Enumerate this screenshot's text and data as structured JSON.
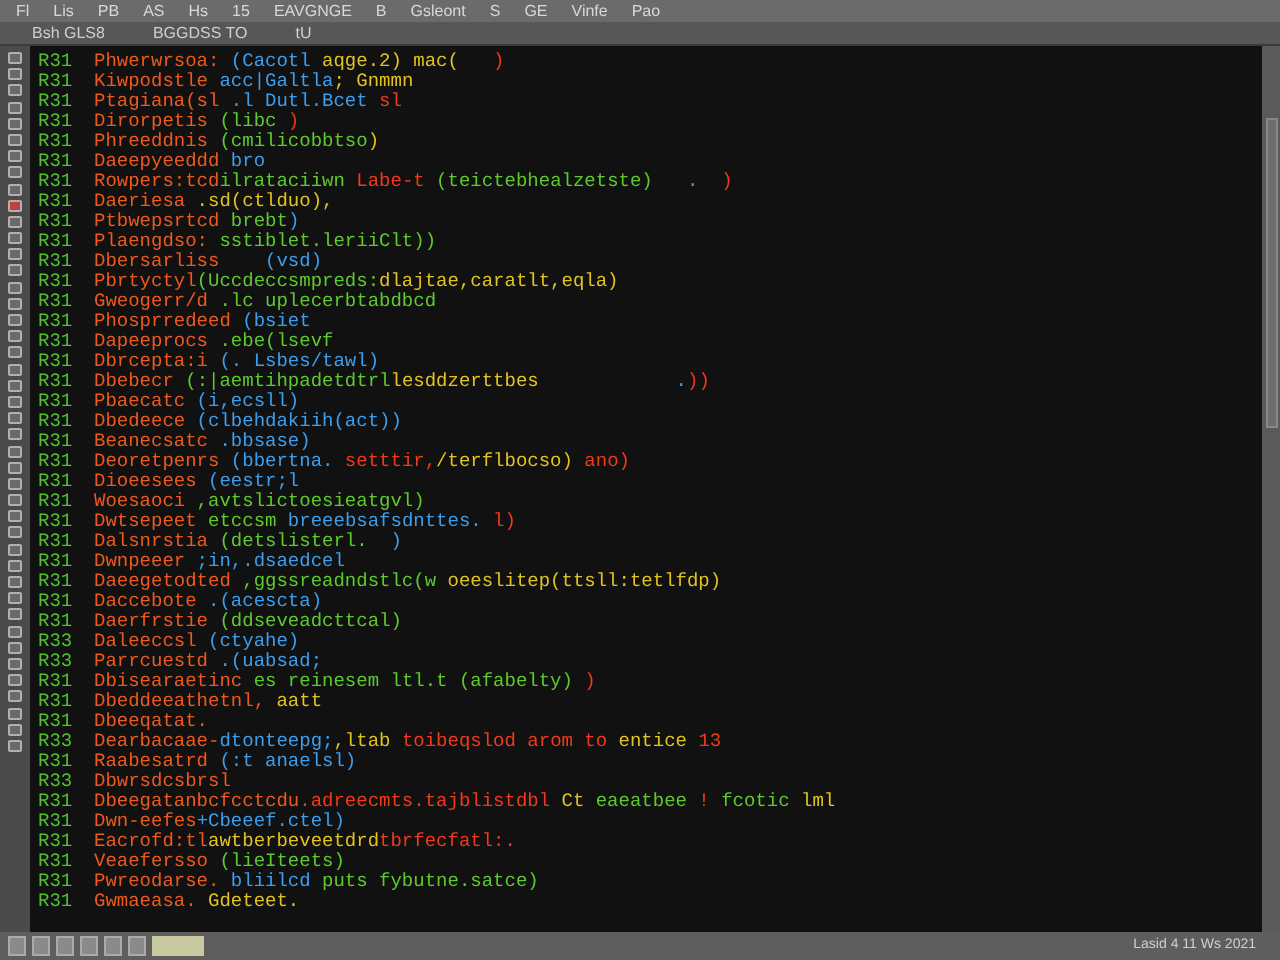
{
  "menu_bar": {
    "items": [
      "Fl",
      "Lis",
      "PB",
      "AS",
      "Hs",
      "15",
      "EAVGNGE",
      "B",
      "Gsleont",
      "S",
      "GE",
      "Vinfe",
      "Pao"
    ]
  },
  "toolbar": {
    "items": [
      "Bsh GLS8",
      "BGGDSS TO",
      "tU"
    ]
  },
  "editor": {
    "lines": [
      {
        "number": "R31",
        "tokens": [
          {
            "kind": "ident",
            "text": "Phwerwrsoa:"
          },
          {
            "kind": "call",
            "text": " (Cacotl"
          },
          {
            "kind": "literal",
            "text": " aqge.2) mac("
          },
          {
            "kind": "punct",
            "text": "   )"
          }
        ]
      },
      {
        "number": "R31",
        "tokens": [
          {
            "kind": "ident",
            "text": "Kiwpodstle"
          },
          {
            "kind": "call",
            "text": " acc|Galtla"
          },
          {
            "kind": "literal",
            "text": "; Gnmmn"
          }
        ]
      },
      {
        "number": "R31",
        "tokens": [
          {
            "kind": "ident",
            "text": "Ptagiana(sl"
          },
          {
            "kind": "call",
            "text": " .l Dutl.Bcet"
          },
          {
            "kind": "punct",
            "text": " sl"
          }
        ]
      },
      {
        "number": "R31",
        "tokens": [
          {
            "kind": "ident",
            "text": "Dirorpetis"
          },
          {
            "kind": "string",
            "text": " (libc"
          },
          {
            "kind": "punct",
            "text": " )"
          }
        ]
      },
      {
        "number": "R31",
        "tokens": [
          {
            "kind": "ident",
            "text": "Phreeddnis"
          },
          {
            "kind": "string",
            "text": " (cmilicobbtso"
          },
          {
            "kind": "literal",
            "text": ")"
          }
        ]
      },
      {
        "number": "R31",
        "tokens": [
          {
            "kind": "ident",
            "text": "Daeepyeeddd"
          },
          {
            "kind": "call",
            "text": " bro"
          }
        ]
      },
      {
        "number": "R31",
        "tokens": [
          {
            "kind": "ident",
            "text": "Rowpers:tcd"
          },
          {
            "kind": "string",
            "text": "ilrataciiwn"
          },
          {
            "kind": "punct",
            "text": " Labe-t"
          },
          {
            "kind": "string",
            "text": " (teictebhealzetste)"
          },
          {
            "kind": "call",
            "text": "   ."
          },
          {
            "kind": "punct",
            "text": "  )"
          }
        ]
      },
      {
        "number": "R31",
        "tokens": [
          {
            "kind": "ident",
            "text": "Daeriesa"
          },
          {
            "kind": "literal",
            "text": " .sd(ctlduo),"
          }
        ]
      },
      {
        "number": "R31",
        "tokens": [
          {
            "kind": "ident",
            "text": "Ptbwepsrtcd"
          },
          {
            "kind": "string",
            "text": " brebt"
          },
          {
            "kind": "call",
            "text": ")"
          }
        ]
      },
      {
        "number": "R31",
        "tokens": [
          {
            "kind": "ident",
            "text": "Plaengdso:"
          },
          {
            "kind": "string",
            "text": " sstiblet.leriiClt))"
          }
        ]
      },
      {
        "number": "R31",
        "tokens": [
          {
            "kind": "ident",
            "text": "Dbersarliss"
          },
          {
            "kind": "call",
            "text": "    (vsd)"
          }
        ]
      },
      {
        "number": "R31",
        "tokens": [
          {
            "kind": "ident",
            "text": "Pbrtyctyl"
          },
          {
            "kind": "string",
            "text": "(Uccdeccsmpreds:"
          },
          {
            "kind": "literal",
            "text": "dlajtae,caratlt,eqla)"
          }
        ]
      },
      {
        "number": "R31",
        "tokens": [
          {
            "kind": "ident",
            "text": "Gweogerr/d"
          },
          {
            "kind": "string",
            "text": " .lc uplecerbtabdbcd"
          }
        ]
      },
      {
        "number": "R31",
        "tokens": [
          {
            "kind": "ident",
            "text": "Phosprredeed"
          },
          {
            "kind": "call",
            "text": " (bsiet"
          }
        ]
      },
      {
        "number": "R31",
        "tokens": [
          {
            "kind": "ident",
            "text": "Dapeeprocs"
          },
          {
            "kind": "string",
            "text": " .ebe(lsevf"
          }
        ]
      },
      {
        "number": "R31",
        "tokens": [
          {
            "kind": "ident",
            "text": "Dbrcepta:i"
          },
          {
            "kind": "call",
            "text": " (. Lsbes/tawl)"
          }
        ]
      },
      {
        "number": "R31",
        "tokens": [
          {
            "kind": "ident",
            "text": "Dbebecr"
          },
          {
            "kind": "string",
            "text": " (:|aemtihpadetdtrl"
          },
          {
            "kind": "literal",
            "text": "lesddzerttbes"
          },
          {
            "kind": "call",
            "text": "            ."
          },
          {
            "kind": "punct",
            "text": "))"
          }
        ]
      },
      {
        "number": "R31",
        "tokens": [
          {
            "kind": "ident",
            "text": "Pbaecatc"
          },
          {
            "kind": "call",
            "text": " (i,ecsll)"
          }
        ]
      },
      {
        "number": "R31",
        "tokens": [
          {
            "kind": "ident",
            "text": "Dbedeece"
          },
          {
            "kind": "call",
            "text": " (clbehdakiih(act))"
          }
        ]
      },
      {
        "number": "R31",
        "tokens": [
          {
            "kind": "ident",
            "text": "Beanecsatc"
          },
          {
            "kind": "call",
            "text": " .bbsase)"
          }
        ]
      },
      {
        "number": "R31",
        "tokens": [
          {
            "kind": "ident",
            "text": "Deoretpenrs"
          },
          {
            "kind": "call",
            "text": " (bbertna."
          },
          {
            "kind": "punct",
            "text": " setttir,"
          },
          {
            "kind": "literal",
            "text": "/terflbocso)"
          },
          {
            "kind": "punct",
            "text": " ano)"
          }
        ]
      },
      {
        "number": "R31",
        "tokens": [
          {
            "kind": "ident",
            "text": "Dioeesees"
          },
          {
            "kind": "call",
            "text": " (eestr;l"
          }
        ]
      },
      {
        "number": "R31",
        "tokens": [
          {
            "kind": "ident",
            "text": "Woesaoci"
          },
          {
            "kind": "string",
            "text": " ,avtslictoesieatgvl)"
          }
        ]
      },
      {
        "number": "R31",
        "tokens": [
          {
            "kind": "ident",
            "text": "Dwtsepeet"
          },
          {
            "kind": "string",
            "text": " etccsm"
          },
          {
            "kind": "call",
            "text": " breeebsafsdnttes."
          },
          {
            "kind": "punct",
            "text": " l)"
          }
        ]
      },
      {
        "number": "R31",
        "tokens": [
          {
            "kind": "ident",
            "text": "Dalsnrstia"
          },
          {
            "kind": "string",
            "text": " (detslisterl."
          },
          {
            "kind": "call",
            "text": "  )"
          }
        ]
      },
      {
        "number": "R31",
        "tokens": [
          {
            "kind": "ident",
            "text": "Dwnpeeer"
          },
          {
            "kind": "call",
            "text": " ;in,.dsaedcel"
          }
        ]
      },
      {
        "number": "R31",
        "tokens": [
          {
            "kind": "ident",
            "text": "Daeegetodted"
          },
          {
            "kind": "string",
            "text": " ,ggssreadndstlc(w"
          },
          {
            "kind": "literal",
            "text": " oeeslitep(ttsll:tetlfdp)"
          }
        ]
      },
      {
        "number": "R31",
        "tokens": [
          {
            "kind": "ident",
            "text": "Daccebote"
          },
          {
            "kind": "call",
            "text": " .(acescta)"
          }
        ]
      },
      {
        "number": "R31",
        "tokens": [
          {
            "kind": "ident",
            "text": "Daerfrstie"
          },
          {
            "kind": "string",
            "text": " (ddseveadcttcal)"
          }
        ]
      },
      {
        "number": "R33",
        "tokens": [
          {
            "kind": "ident",
            "text": "Daleeccsl"
          },
          {
            "kind": "call",
            "text": " (ctyahe)"
          }
        ]
      },
      {
        "number": "R33",
        "tokens": [
          {
            "kind": "ident",
            "text": "Parrcuestd"
          },
          {
            "kind": "call",
            "text": " .(uabsad;"
          }
        ]
      },
      {
        "number": "R31",
        "tokens": [
          {
            "kind": "ident",
            "text": "Dbisearaetinc"
          },
          {
            "kind": "string",
            "text": " es reinesem ltl.t (afabelty)"
          },
          {
            "kind": "punct",
            "text": " )"
          }
        ]
      },
      {
        "number": "R31",
        "tokens": [
          {
            "kind": "ident",
            "text": "Dbeddeeathetnl,"
          },
          {
            "kind": "literal",
            "text": " aatt"
          }
        ]
      },
      {
        "number": "R31",
        "tokens": [
          {
            "kind": "ident",
            "text": "Dbeeqatat."
          }
        ]
      },
      {
        "number": "R33",
        "tokens": [
          {
            "kind": "ident",
            "text": "Dearbacaae-"
          },
          {
            "kind": "call",
            "text": "dtonteepg;"
          },
          {
            "kind": "literal",
            "text": ",ltab"
          },
          {
            "kind": "punct",
            "text": " toibeqslod arom to"
          },
          {
            "kind": "literal",
            "text": " entice"
          },
          {
            "kind": "punct",
            "text": " 13"
          }
        ]
      },
      {
        "number": "R31",
        "tokens": [
          {
            "kind": "ident",
            "text": "Raabesatrd"
          },
          {
            "kind": "call",
            "text": " (:t anaelsl)"
          }
        ]
      },
      {
        "number": "R33",
        "tokens": [
          {
            "kind": "ident",
            "text": "Dbwrsdcsbrsl"
          }
        ]
      },
      {
        "number": "R31",
        "tokens": [
          {
            "kind": "ident",
            "text": "Dbeegatanbcfcctcdu"
          },
          {
            "kind": "punct",
            "text": ".adreecmts.tajblistdbl"
          },
          {
            "kind": "literal",
            "text": " Ct"
          },
          {
            "kind": "string",
            "text": " eaeatbee"
          },
          {
            "kind": "punct",
            "text": " !"
          },
          {
            "kind": "string",
            "text": " fcotic"
          },
          {
            "kind": "literal",
            "text": " lml"
          }
        ]
      },
      {
        "number": "R31",
        "tokens": [
          {
            "kind": "ident",
            "text": "Dwn-eefes"
          },
          {
            "kind": "call",
            "text": "+Cbeeef.ctel)"
          }
        ]
      },
      {
        "number": "R31",
        "tokens": [
          {
            "kind": "ident",
            "text": "Eacrofd:tl"
          },
          {
            "kind": "literal",
            "text": "awtberbeveetdrd"
          },
          {
            "kind": "punct",
            "text": "tbrfecfatl:."
          }
        ]
      },
      {
        "number": "R31",
        "tokens": [
          {
            "kind": "ident",
            "text": "Veaefersso"
          },
          {
            "kind": "string",
            "text": " (lieIteets)"
          }
        ]
      },
      {
        "number": "R31",
        "tokens": [
          {
            "kind": "ident",
            "text": "Pwreodarse."
          },
          {
            "kind": "call",
            "text": " bliilcd"
          },
          {
            "kind": "string",
            "text": " puts fybutne.satce)"
          }
        ]
      },
      {
        "number": "R31",
        "tokens": [
          {
            "kind": "ident",
            "text": "Gwmaeasa."
          },
          {
            "kind": "literal",
            "text": " Gdeteet."
          }
        ]
      }
    ]
  },
  "status_bar": {
    "text": "Lasid 4 11 Ws 2021"
  }
}
